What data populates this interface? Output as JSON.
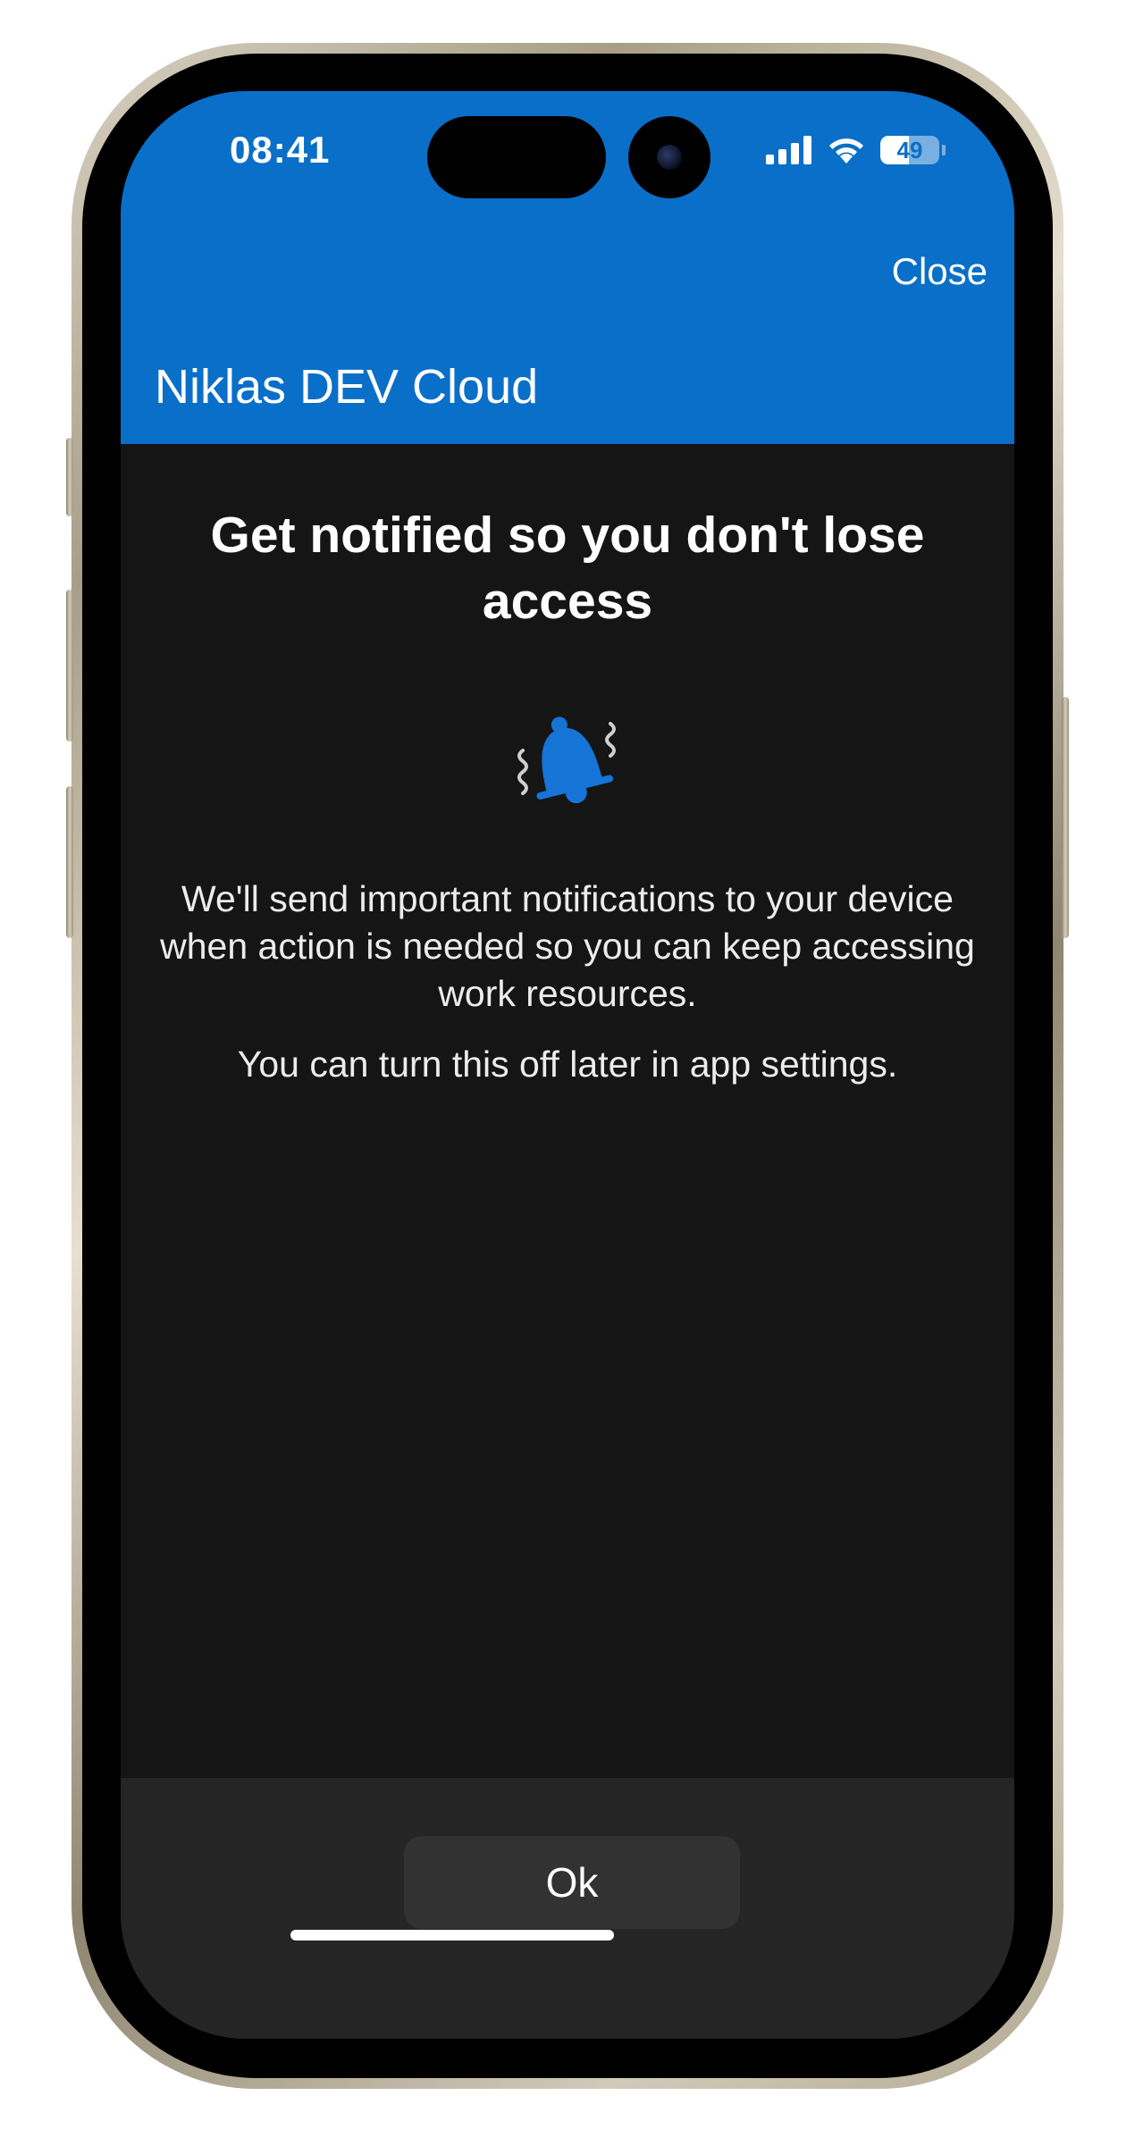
{
  "status_bar": {
    "time": "08:41",
    "battery_level": 49,
    "battery_label": "49",
    "signal_icon": "cellular-signal-icon",
    "wifi_icon": "wifi-icon",
    "battery_icon": "battery-icon"
  },
  "header": {
    "close_label": "Close",
    "title": "Niklas DEV Cloud",
    "background_color": "#0a6fc8"
  },
  "content": {
    "heading": "Get notified so you don't lose access",
    "icon": "ringing-bell-icon",
    "description": "We'll send important notifications to your device when action is needed so you can keep accessing work resources.",
    "note": "You can turn this off later in app settings."
  },
  "footer": {
    "ok_label": "Ok"
  },
  "colors": {
    "background": "#151515",
    "footer": "#252525",
    "button": "#323232",
    "bell": "#1574d6"
  }
}
